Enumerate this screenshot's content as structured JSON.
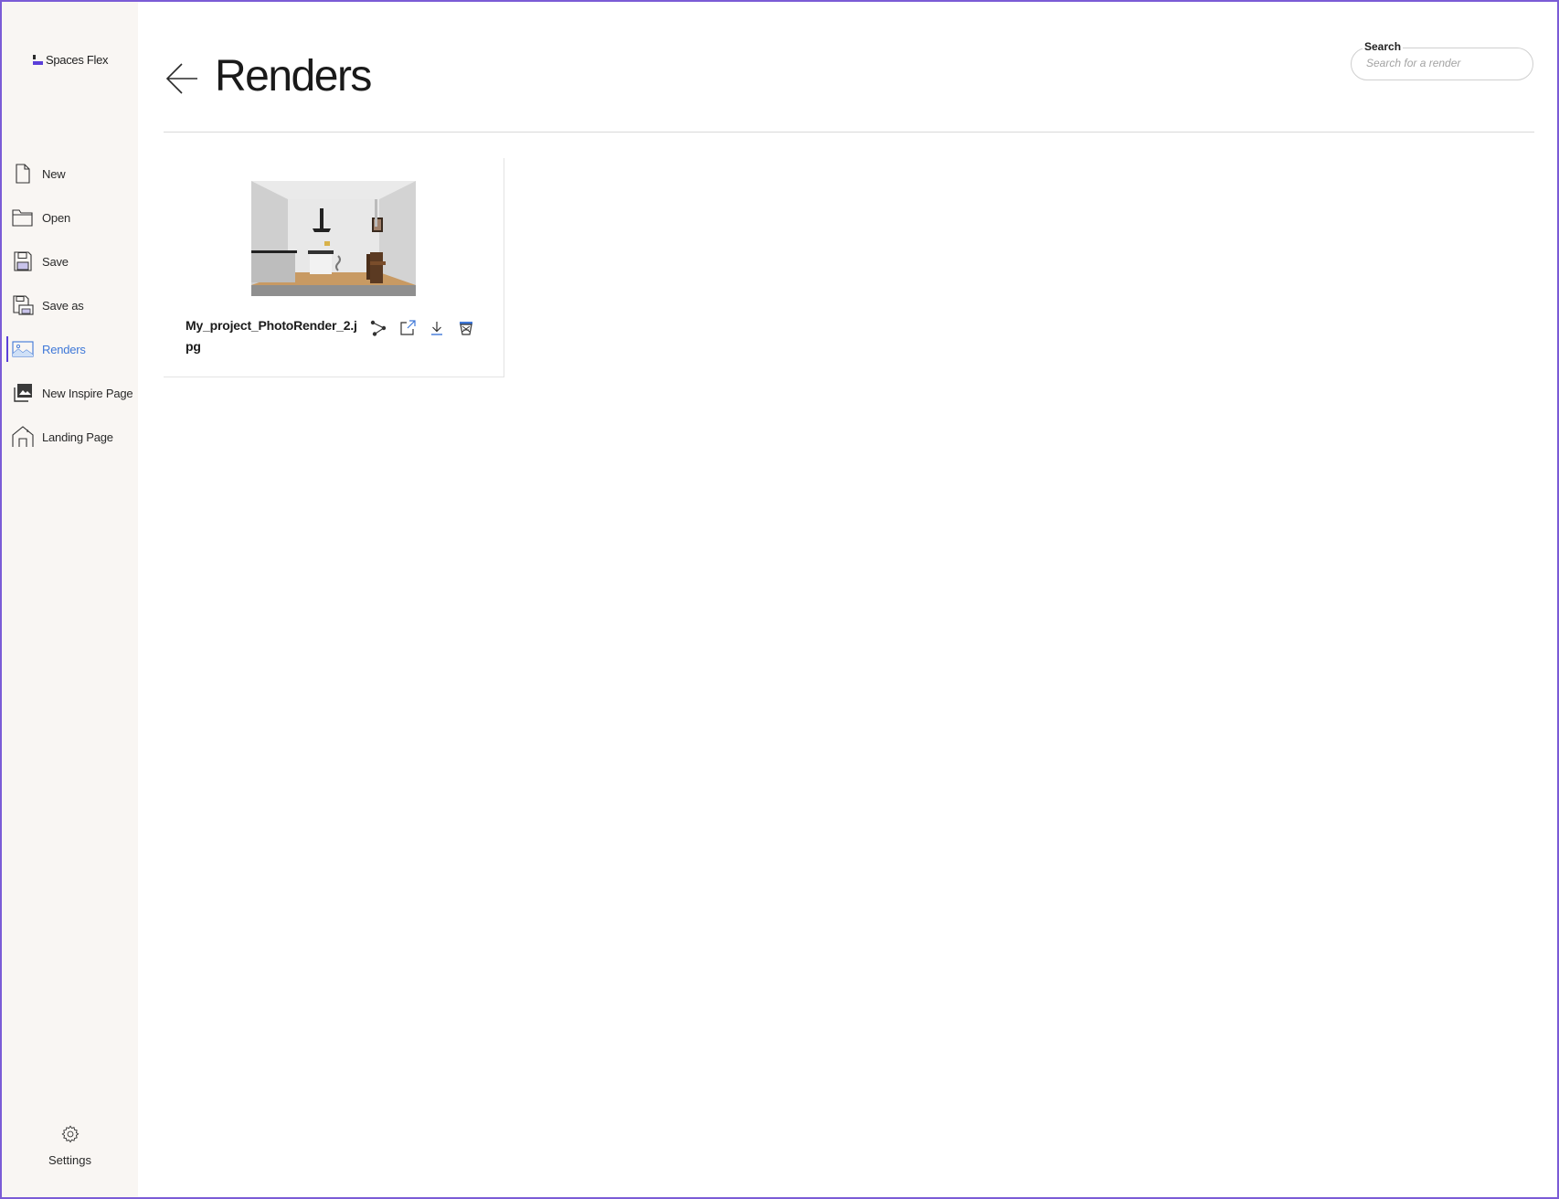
{
  "app": {
    "brand": "Spaces Flex"
  },
  "sidebar": {
    "items": [
      {
        "label": "New",
        "icon": "new-file-icon"
      },
      {
        "label": "Open",
        "icon": "folder-icon"
      },
      {
        "label": "Save",
        "icon": "floppy-disk-icon"
      },
      {
        "label": "Save as",
        "icon": "save-as-icon"
      },
      {
        "label": "Renders",
        "icon": "image-icon",
        "active": true
      },
      {
        "label": "New Inspire Page",
        "icon": "gallery-icon"
      },
      {
        "label": "Landing Page",
        "icon": "home-icon"
      }
    ],
    "settings_label": "Settings"
  },
  "header": {
    "title": "Renders"
  },
  "search": {
    "label": "Search",
    "placeholder": "Search for a render",
    "value": ""
  },
  "renders": [
    {
      "file_name": "My_project_PhotoRender_2.jpg"
    }
  ],
  "colors": {
    "accent": "#5b3fd9",
    "active_text": "#3f78d8",
    "sidebar_bg": "#f9f6f3",
    "frame": "#7b5cd6"
  }
}
